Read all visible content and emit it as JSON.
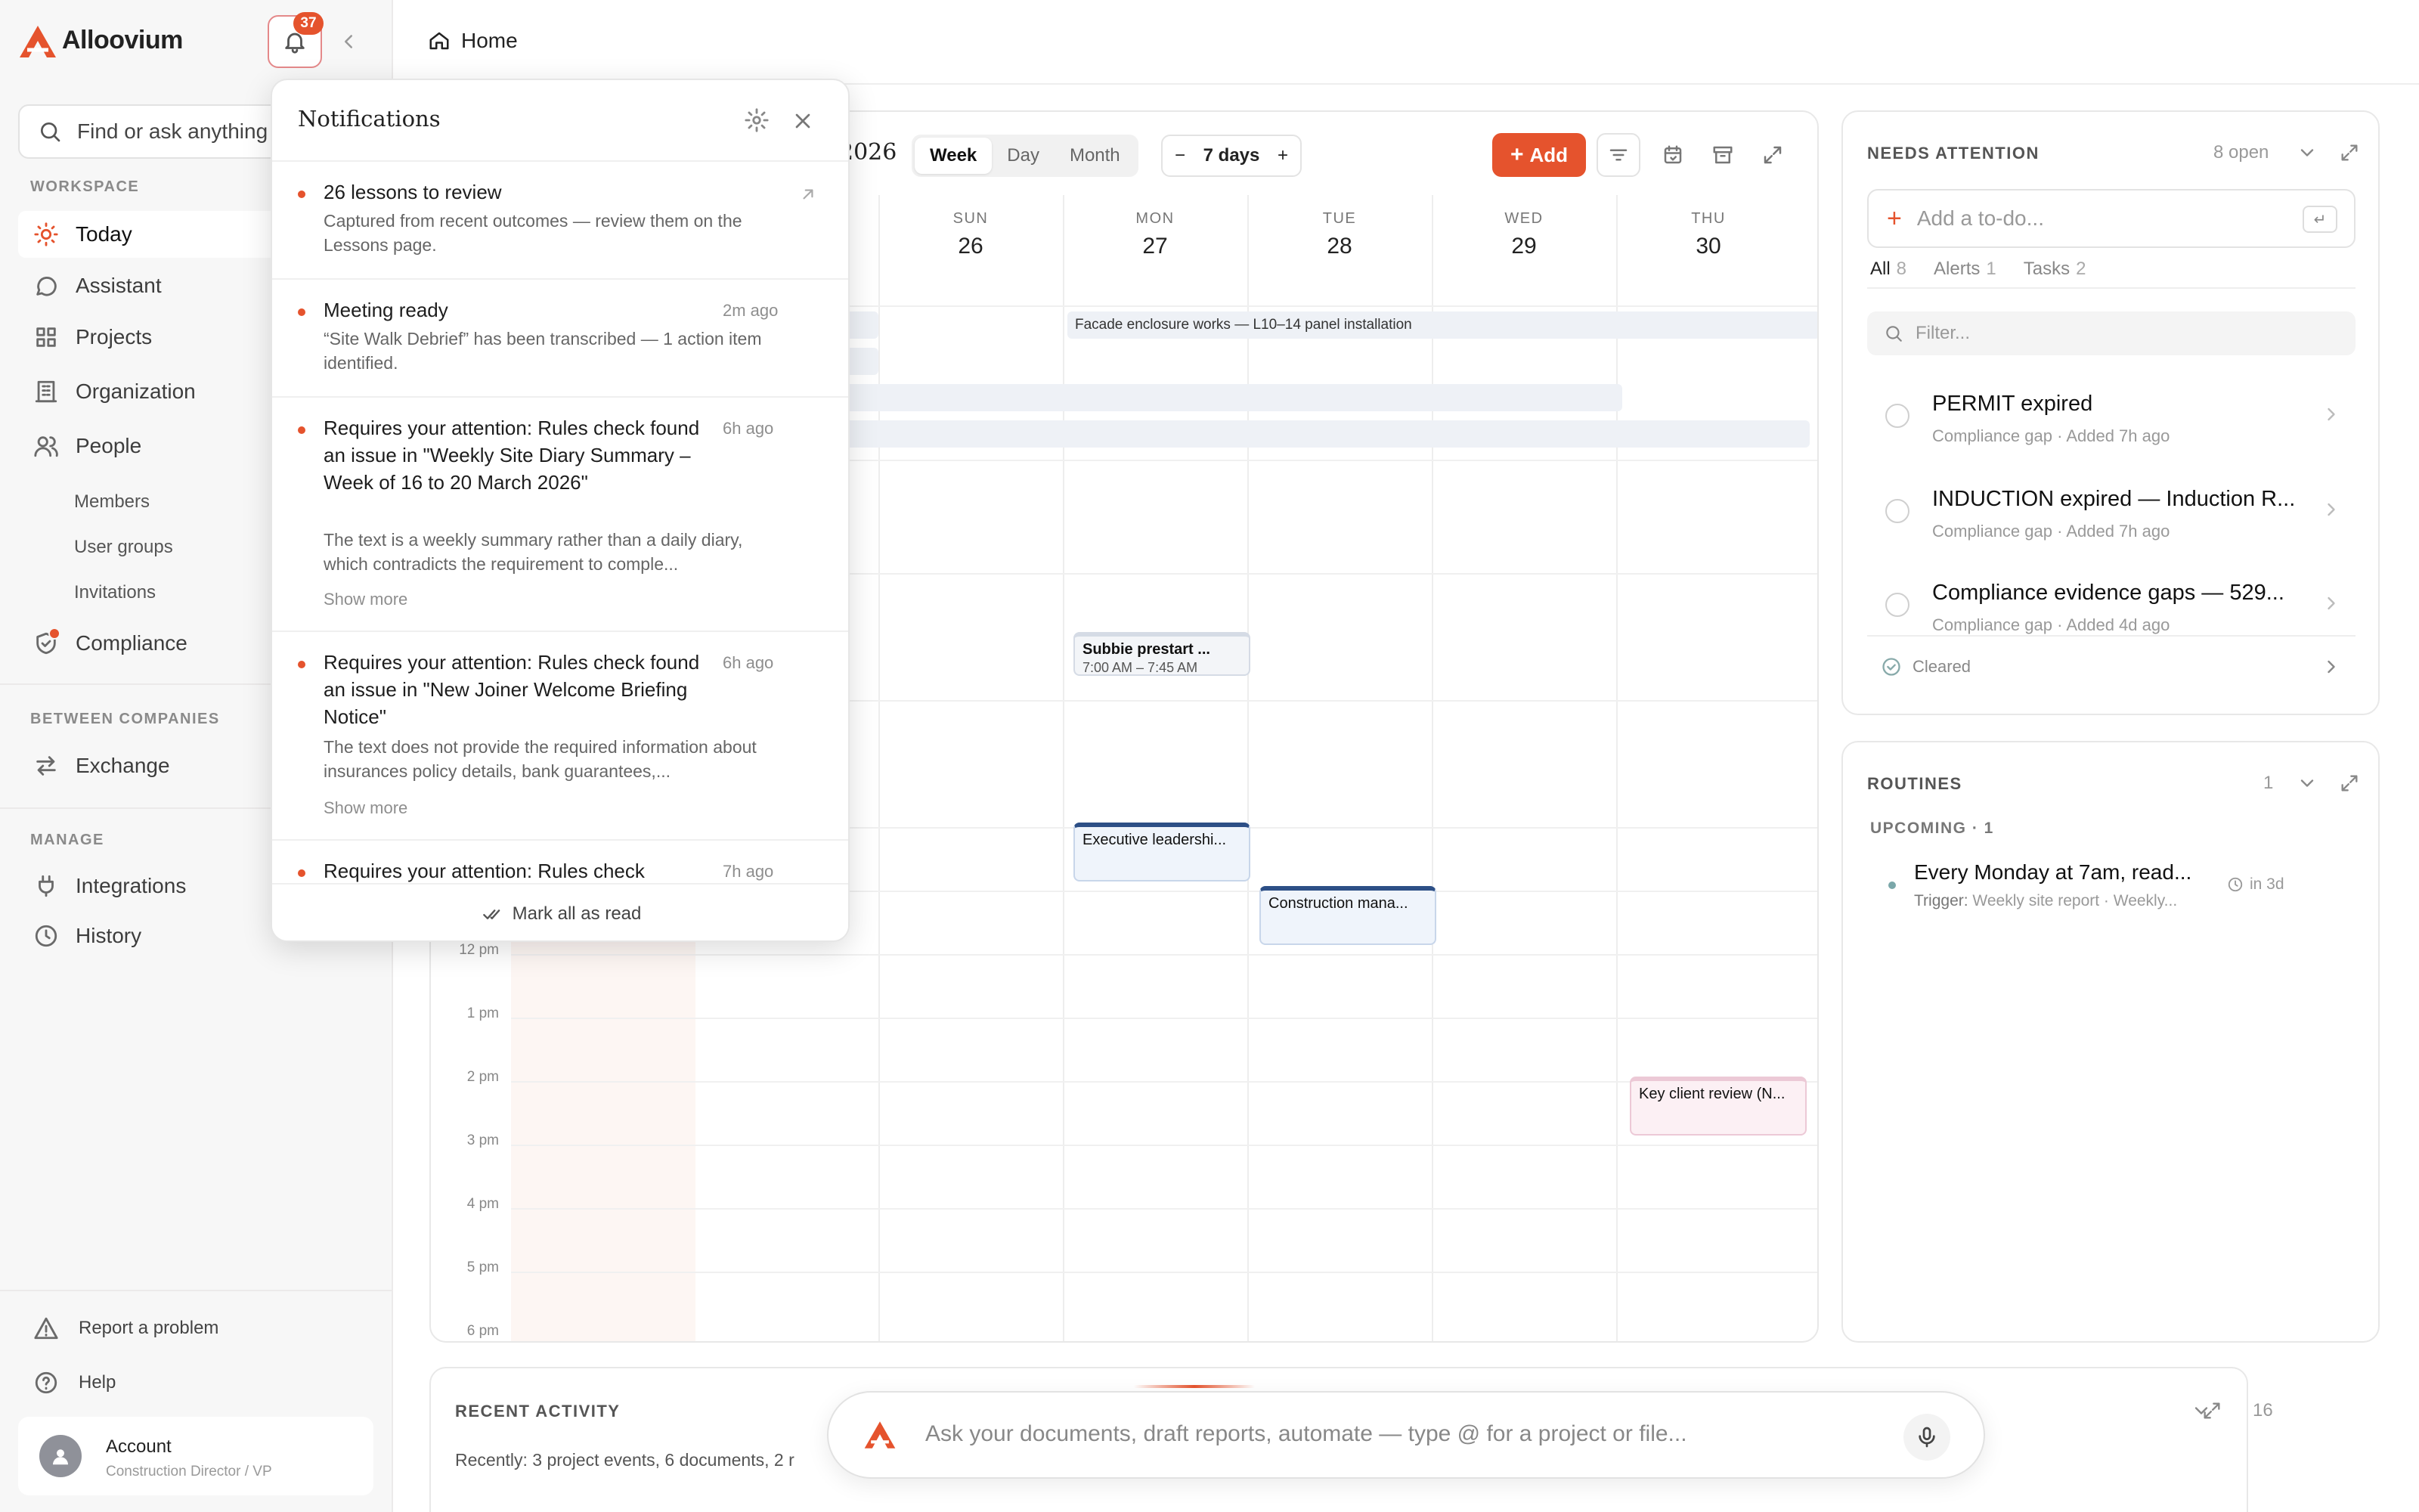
{
  "app": {
    "name": "Alloovium",
    "notification_count": "37"
  },
  "sidebar": {
    "search_placeholder": "Find or ask anything",
    "sections": {
      "workspace": "WORKSPACE",
      "between": "BETWEEN COMPANIES",
      "manage": "MANAGE"
    },
    "items": {
      "today": "Today",
      "assistant": "Assistant",
      "projects": "Projects",
      "organization": "Organization",
      "people": "People",
      "members": "Members",
      "user_groups": "User groups",
      "invitations": "Invitations",
      "compliance": "Compliance",
      "exchange": "Exchange",
      "integrations": "Integrations",
      "history": "History"
    },
    "footer": {
      "report": "Report a problem",
      "help": "Help"
    },
    "account": {
      "name": "Account",
      "role": "Construction Director / VP"
    }
  },
  "header": {
    "breadcrumb": "Home"
  },
  "calendar": {
    "year_suffix": "2026",
    "views": [
      "Week",
      "Day",
      "Month"
    ],
    "active_view": "Week",
    "range_label": "7 days",
    "add_label": "Add",
    "days": [
      {
        "name": "SUN",
        "date": "26"
      },
      {
        "name": "MON",
        "date": "27"
      },
      {
        "name": "TUE",
        "date": "28"
      },
      {
        "name": "WED",
        "date": "29"
      },
      {
        "name": "THU",
        "date": "30"
      }
    ],
    "allday_event": "Facade enclosure works — L10–14 panel installation",
    "time_labels": [
      "12 pm",
      "1 pm",
      "2 pm",
      "3 pm",
      "4 pm",
      "5 pm",
      "6 pm"
    ],
    "events": {
      "subbie": {
        "title": "Subbie prestart ...",
        "time": "7:00 AM – 7:45 AM"
      },
      "exec": {
        "title": "Executive leadershi..."
      },
      "construction": {
        "title": "Construction mana..."
      },
      "client": {
        "title": "Key client review (N..."
      }
    }
  },
  "notifications": {
    "title": "Notifications",
    "items": [
      {
        "title": "26 lessons to review",
        "time": "",
        "body": "Captured from recent outcomes — review them on the Lessons page.",
        "more": ""
      },
      {
        "title": "Meeting ready",
        "time": "2m ago",
        "body": "“Site Walk Debrief” has been transcribed — 1 action item identified.",
        "more": ""
      },
      {
        "title": "Requires your attention: Rules check found an issue in \"Weekly Site Diary Summary – Week of 16 to 20 March 2026\"",
        "time": "6h ago",
        "body": "The text is a weekly summary rather than a daily diary, which contradicts the requirement to comple...",
        "more": "Show more"
      },
      {
        "title": "Requires your attention: Rules check found an issue in \"New Joiner Welcome Briefing Notice\"",
        "time": "6h ago",
        "body": "The text does not provide the required information about insurances policy details, bank guarantees,...",
        "more": "Show more"
      },
      {
        "title": "Requires your attention: Rules check",
        "time": "7h ago",
        "body": "",
        "more": ""
      }
    ],
    "mark_all": "Mark all as read"
  },
  "needs_attention": {
    "title": "NEEDS ATTENTION",
    "open_count": "8 open",
    "todo_placeholder": "Add a to-do...",
    "tabs": [
      {
        "label": "All",
        "count": "8"
      },
      {
        "label": "Alerts",
        "count": "1"
      },
      {
        "label": "Tasks",
        "count": "2"
      }
    ],
    "filter_placeholder": "Filter...",
    "items": [
      {
        "title": "PERMIT expired",
        "category": "Compliance gap",
        "added": "Added 7h ago"
      },
      {
        "title": "INDUCTION expired — Induction R...",
        "category": "Compliance gap",
        "added": "Added 7h ago"
      },
      {
        "title": "Compliance evidence gaps — 529...",
        "category": "Compliance gap",
        "added": "Added 4d ago"
      }
    ],
    "cleared_label": "Cleared"
  },
  "routines": {
    "title": "ROUTINES",
    "count": "1",
    "upcoming_label": "UPCOMING · 1",
    "item": {
      "title": "Every Monday at 7am, read...",
      "trigger_label": "Trigger:",
      "trigger_value": "Weekly site report · Weekly...",
      "due": "in 3d"
    }
  },
  "recent_activity": {
    "title": "RECENT ACTIVITY",
    "count": "16",
    "summary": "Recently: 3 project events, 6 documents, 2 r"
  },
  "ask": {
    "placeholder": "Ask your documents, draft reports, automate — type @ for a project or file..."
  },
  "colors": {
    "accent": "#e5532d",
    "sidebar_bg": "#f7f7f7",
    "event_border": "#c8d6ea"
  }
}
